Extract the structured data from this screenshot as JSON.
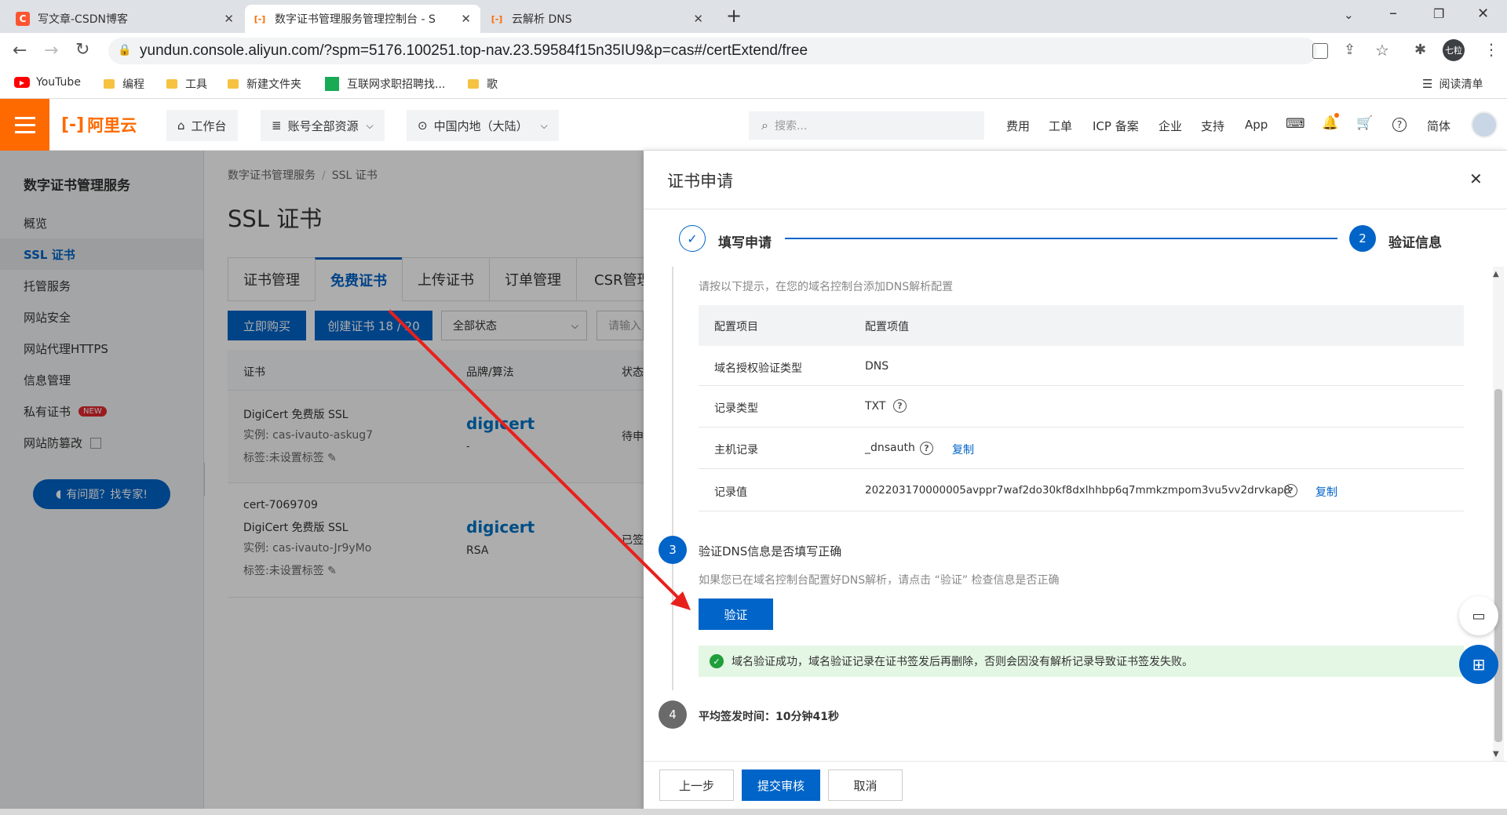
{
  "browser": {
    "tabs": [
      {
        "title": "写文章-CSDN博客",
        "favicon": "C",
        "color": "#fc5531"
      },
      {
        "title": "数字证书管理服务管理控制台 - SSL",
        "favicon": "[-]",
        "color": "#ff6a00"
      },
      {
        "title": "云解析 DNS",
        "favicon": "[-]",
        "color": "#ff6a00"
      }
    ],
    "url": "yundun.console.aliyun.com/?spm=5176.100251.top-nav.23.59584f15n35IU9&p=cas#/certExtend/free",
    "profile_label": "七粒",
    "bookmarks": [
      "YouTube",
      "编程",
      "工具",
      "新建文件夹",
      "互联网求职招聘找...",
      "歌"
    ],
    "reading_list": "阅读清单"
  },
  "topbar": {
    "logo": "阿里云",
    "workbench": "工作台",
    "account_resources": "账号全部资源",
    "region": "中国内地（大陆）",
    "search_placeholder": "搜索...",
    "links": [
      "费用",
      "工单",
      "ICP 备案",
      "企业",
      "支持",
      "App"
    ],
    "lang": "简体"
  },
  "sidebar": {
    "title": "数字证书管理服务",
    "items": [
      "概览",
      "SSL 证书",
      "托管服务",
      "网站安全",
      "网站代理HTTPS",
      "信息管理",
      "私有证书",
      "网站防篡改"
    ],
    "new_badge": "NEW",
    "help_button": "有问题？找专家!"
  },
  "main": {
    "breadcrumb": [
      "数字证书管理服务",
      "SSL 证书"
    ],
    "page_title": "SSL 证书",
    "tabs": [
      "证书管理",
      "免费证书",
      "上传证书",
      "订单管理",
      "CSR管理"
    ],
    "buy_button": "立即购买",
    "create_button": "创建证书 18 / 20",
    "status_select": "全部状态",
    "search_placeholder": "请输入",
    "columns": [
      "证书",
      "品牌/算法",
      "状态"
    ],
    "rows": [
      {
        "name": "",
        "product": "DigiCert 免费版 SSL",
        "instance": "实例: cas-ivauto-askug7",
        "tag": "标签:未设置标签",
        "brand": "digicert",
        "algo": "-",
        "status": "待申"
      },
      {
        "name": "cert-7069709",
        "product": "DigiCert 免费版 SSL",
        "instance": "实例: cas-ivauto-Jr9yMo",
        "tag": "标签:未设置标签",
        "brand": "digicert",
        "algo": "RSA",
        "status": "已签"
      }
    ]
  },
  "drawer": {
    "title": "证书申请",
    "step1": "填写申请",
    "step2_num": "2",
    "step2": "验证信息",
    "hint": "请按以下提示，在您的域名控制台添加DNS解析配置",
    "table_headers": [
      "配置项目",
      "配置项值"
    ],
    "table_rows": [
      {
        "key": "域名授权验证类型",
        "value": "DNS",
        "help": false,
        "copy": false
      },
      {
        "key": "记录类型",
        "value": "TXT",
        "help": true,
        "copy": false
      },
      {
        "key": "主机记录",
        "value": "_dnsauth",
        "help": true,
        "copy": true
      },
      {
        "key": "记录值",
        "value": "202203170000005avppr7waf2do30kf8dxlhhbp6q7mmkzmpom3vu5vv2drvkap8",
        "help": true,
        "copy": true
      }
    ],
    "copy_label": "复制",
    "step3_num": "3",
    "step3_title": "验证DNS信息是否填写正确",
    "step3_hint": "如果您已在域名控制台配置好DNS解析，请点击 “验证” 检查信息是否正确",
    "verify_button": "验证",
    "success_msg": "域名验证成功，域名验证记录在证书签发后再删除，否则会因没有解析记录导致证书签发失败。",
    "step4_num": "4",
    "step4_text": "平均签发时间：10分钟41秒",
    "footer": [
      "上一步",
      "提交审核",
      "取消"
    ]
  },
  "colors": {
    "accent": "#0064c8",
    "brand": "#ff6a00",
    "success_bg": "#e4f6e4",
    "success": "#1f9e3a"
  }
}
